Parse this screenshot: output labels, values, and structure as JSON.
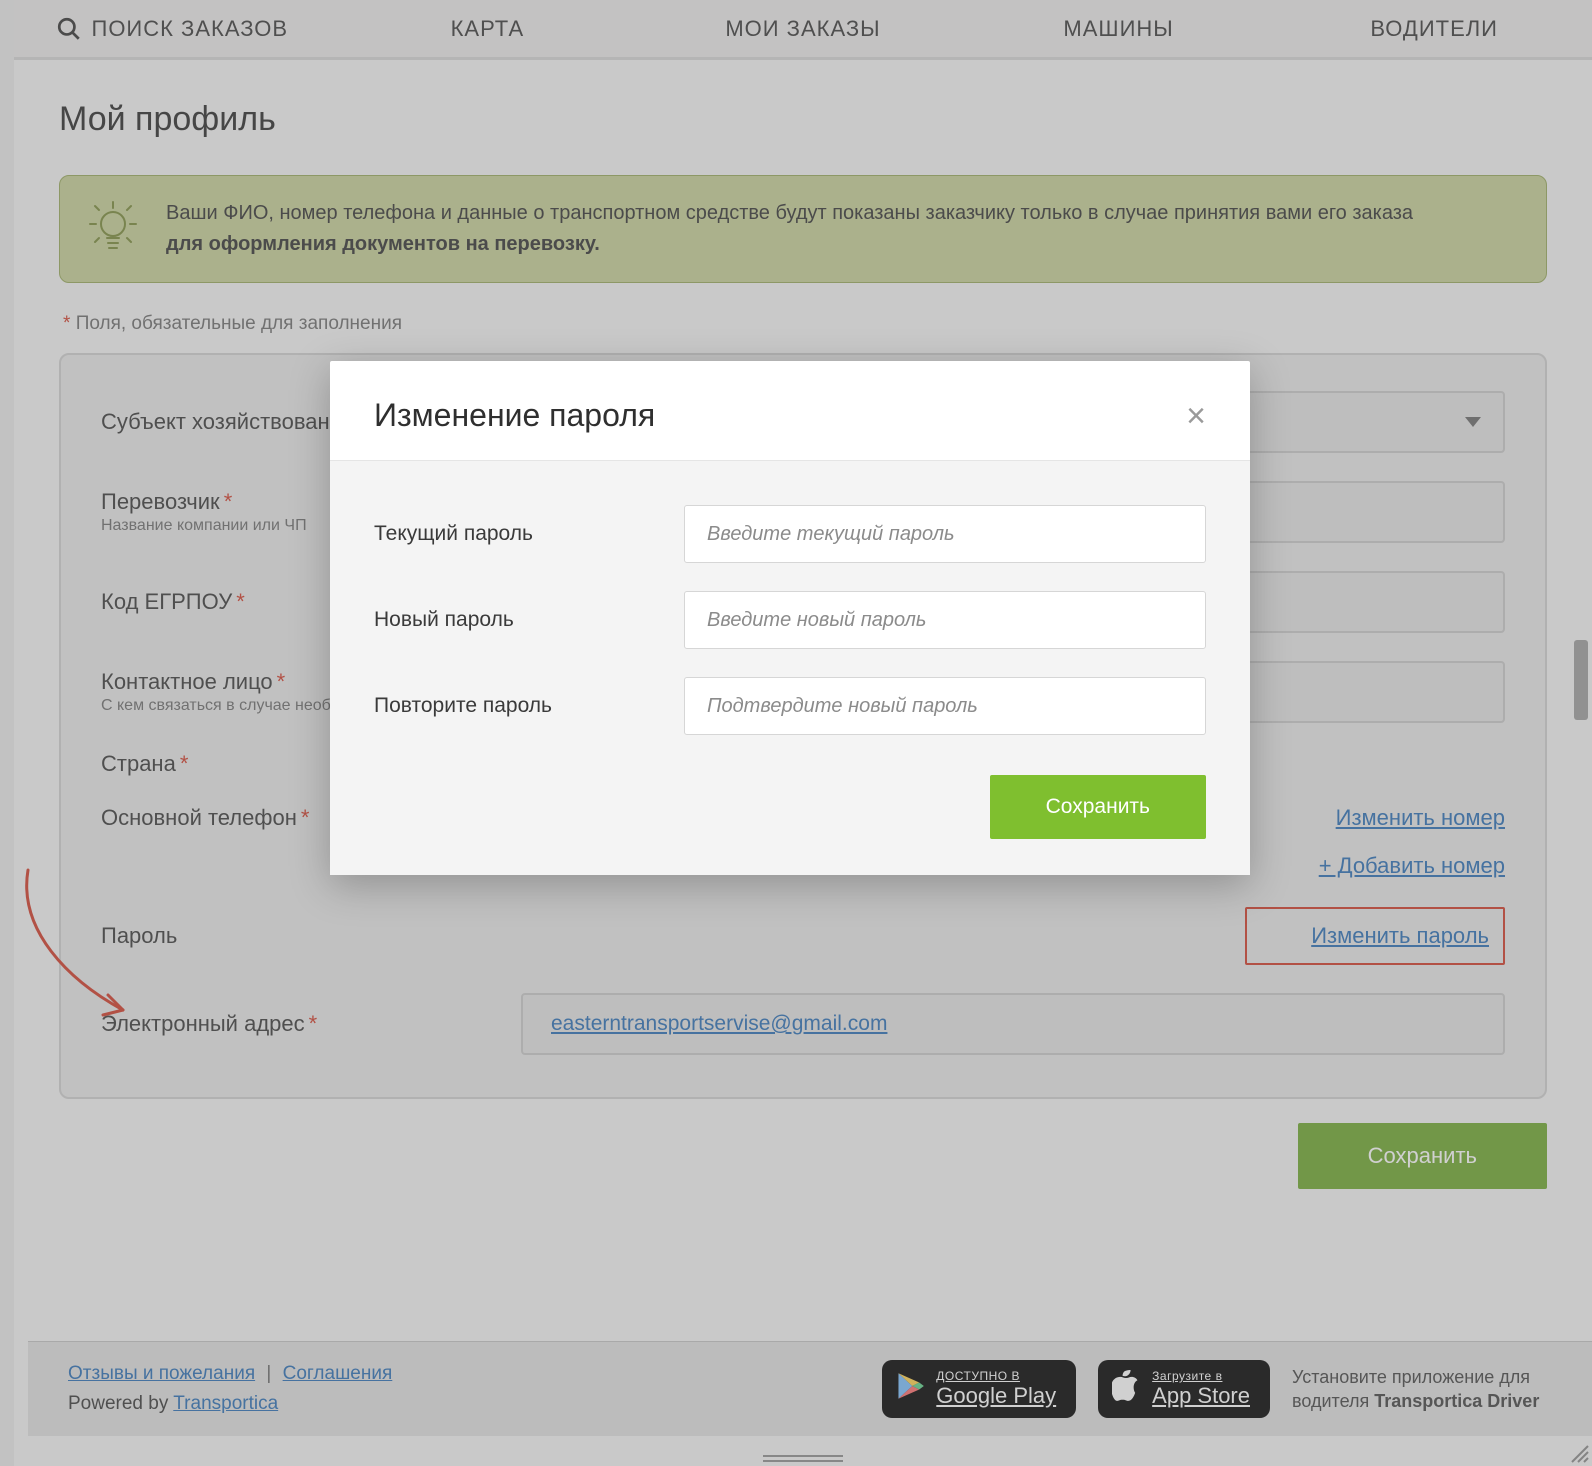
{
  "nav": {
    "search": "ПОИСК ЗАКАЗОВ",
    "map": "КАРТА",
    "my_orders": "МОИ ЗАКАЗЫ",
    "vehicles": "МАШИНЫ",
    "drivers": "ВОДИТЕЛИ"
  },
  "page_title": "Мой профиль",
  "notice": {
    "line1": "Ваши ФИО, номер телефона и данные о транспортном средстве будут показаны заказчику только в случае принятия вами его заказа",
    "line2": "для оформления документов на перевозку."
  },
  "required_note": "Поля, обязательные для заполнения",
  "form": {
    "entity_label": "Субъект хозяйствования",
    "carrier_label": "Перевозчик",
    "carrier_sub": "Название компании или ЧП",
    "egrpou_label": "Код ЕГРПОУ",
    "contact_label": "Контактное лицо",
    "contact_sub": "С кем связаться в случае необходимости",
    "country_label": "Страна",
    "phone_label": "Основной телефон",
    "change_number": "Изменить номер",
    "add_number": "+ Добавить номер",
    "password_label": "Пароль",
    "change_password": "Изменить пароль",
    "email_label": "Электронный адрес",
    "email_value": "easterntransportservise@gmail.com",
    "save": "Сохранить"
  },
  "modal": {
    "title": "Изменение пароля",
    "current_label": "Текущий пароль",
    "current_ph": "Введите текущий пароль",
    "new_label": "Новый пароль",
    "new_ph": "Введите новый пароль",
    "repeat_label": "Повторите пароль",
    "repeat_ph": "Подтвердите новый пароль",
    "save": "Сохранить"
  },
  "footer": {
    "feedback": "Отзывы и пожелания",
    "agreements": "Соглашения",
    "powered_prefix": "Powered by ",
    "powered_link": "Transportica",
    "gp_top": "ДОСТУПНО В",
    "gp_bot": "Google Play",
    "as_top": "Загрузите в",
    "as_bot": "App Store",
    "driver_prefix": "Установите приложение для водителя ",
    "driver_app": "Transportica Driver"
  }
}
